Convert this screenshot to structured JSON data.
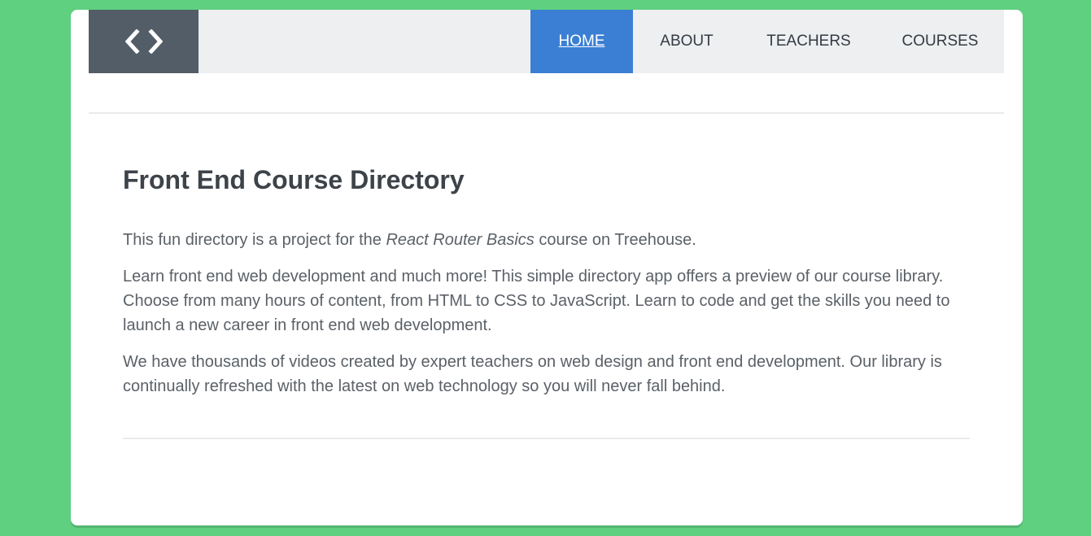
{
  "logo": {
    "icon": "code-brackets-icon"
  },
  "nav": {
    "items": [
      {
        "label": "HOME",
        "active": true
      },
      {
        "label": "ABOUT",
        "active": false
      },
      {
        "label": "TEACHERS",
        "active": false
      },
      {
        "label": "COURSES",
        "active": false
      }
    ]
  },
  "main": {
    "title": "Front End Course Directory",
    "intro": {
      "before": "This fun directory is a project for the ",
      "emphasis": "React Router Basics",
      "after": " course on Treehouse."
    },
    "paragraph2": "Learn front end web development and much more! This simple directory app offers a preview of our course library. Choose from many hours of content, from HTML to CSS to JavaScript. Learn to code and get the skills you need to launch a new career in front end web development.",
    "paragraph3": "We have thousands of videos created by expert teachers on web design and front end development. Our library is continually refreshed with the latest on web technology so you will never fall behind."
  },
  "colors": {
    "background": "#5fcf80",
    "header": "#eeeff1",
    "logo": "#525d68",
    "active_nav": "#3b7fd4"
  }
}
